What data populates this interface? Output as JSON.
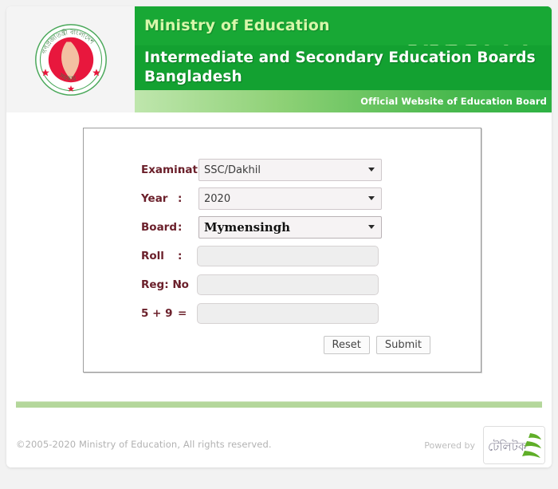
{
  "header": {
    "ministry_title": "Ministry of Education",
    "main_title_line1": "Intermediate and Secondary Education Boards",
    "main_title_line2": "Bangladesh",
    "subtitle": "Official Website of Education Board",
    "logo_alt": "Government of Bangladesh seal",
    "colors": {
      "banner_green": "#17a634",
      "ministry_text": "#d7f7aa",
      "subtitle_bar_light": "#bfe6ad",
      "subtitle_bar_dark": "#2db243"
    }
  },
  "form": {
    "rows": [
      {
        "label": "Examination",
        "separator": ":",
        "type": "select",
        "value": "SSC/Dakhil"
      },
      {
        "label": "Year",
        "separator": ":",
        "type": "select",
        "value": "2020"
      },
      {
        "label": "Board",
        "separator": ":",
        "type": "select",
        "value": "Mymensingh"
      },
      {
        "label": "Roll",
        "separator": ":",
        "type": "text",
        "value": "",
        "placeholder": ""
      },
      {
        "label": "Reg: No",
        "separator": ":",
        "type": "text",
        "value": "",
        "placeholder": ""
      },
      {
        "label": "5 + 9",
        "separator": "=",
        "type": "text",
        "value": "",
        "placeholder": ""
      }
    ],
    "reset_label": "Reset",
    "submit_label": "Submit",
    "label_color": "#6b202b"
  },
  "footer": {
    "copyright": "©2005-2020 Ministry of Education, All rights reserved.",
    "powered_by": "Powered by",
    "partner_logo_text": "টেলিটক",
    "partner_name": "Teletalk"
  }
}
